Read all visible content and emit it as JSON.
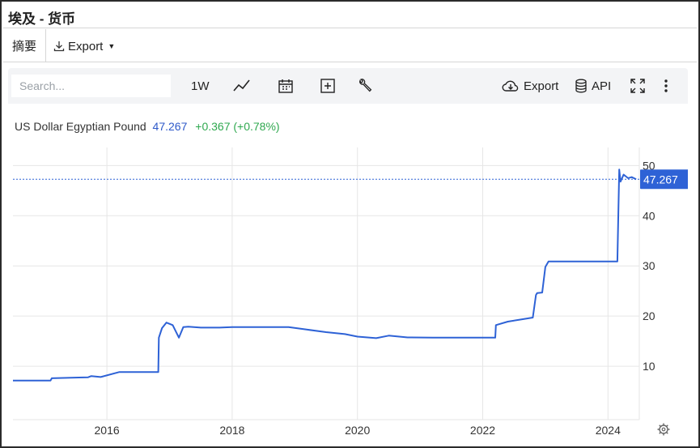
{
  "window": {
    "title": "埃及 - 货币"
  },
  "tabs": {
    "summary": "摘要",
    "export": "Export"
  },
  "toolbar": {
    "search_placeholder": "Search...",
    "interval": "1W",
    "export": "Export",
    "api": "API"
  },
  "legend": {
    "name": "US Dollar Egyptian Pound",
    "price": "47.267",
    "change": "+0.367 (+0.78%)"
  },
  "colors": {
    "line": "#2e62d6",
    "price_tag": "#2e62d6",
    "change": "#2fa84f"
  },
  "chart_data": {
    "type": "line",
    "title": "US Dollar Egyptian Pound",
    "xlabel": "",
    "ylabel": "",
    "xlim": [
      2014.5,
      2024.5
    ],
    "ylim": [
      0,
      52
    ],
    "x_ticks": [
      "2016",
      "2018",
      "2020",
      "2022",
      "2024"
    ],
    "y_ticks": [
      "10",
      "20",
      "30",
      "40",
      "50"
    ],
    "last_value": "47.267",
    "series": [
      {
        "x": [
          2014.5,
          2015.1,
          2015.12,
          2015.55,
          2015.7,
          2015.75,
          2015.9,
          2016.2,
          2016.21,
          2016.82,
          2016.83,
          2016.88,
          2016.95,
          2017.05,
          2017.15,
          2017.22,
          2017.3,
          2017.5,
          2017.8,
          2018.0,
          2018.5,
          2018.9,
          2019.2,
          2019.5,
          2019.8,
          2020.0,
          2020.3,
          2020.5,
          2020.8,
          2021.2,
          2021.8,
          2022.2,
          2022.21,
          2022.4,
          2022.6,
          2022.8,
          2022.85,
          2022.87,
          2022.95,
          2023.0,
          2023.05,
          2023.2,
          2023.5,
          2024.0,
          2024.15,
          2024.18,
          2024.2,
          2024.25,
          2024.32,
          2024.38,
          2024.45
        ],
        "y": [
          7.15,
          7.15,
          7.6,
          7.75,
          7.8,
          8.05,
          7.85,
          8.85,
          8.85,
          8.85,
          15.7,
          17.6,
          18.7,
          18.2,
          15.7,
          17.8,
          17.9,
          17.7,
          17.7,
          17.8,
          17.8,
          17.8,
          17.3,
          16.8,
          16.4,
          15.9,
          15.6,
          16.1,
          15.75,
          15.7,
          15.7,
          15.7,
          18.2,
          18.9,
          19.3,
          19.7,
          24.2,
          24.6,
          24.7,
          29.8,
          30.9,
          30.9,
          30.9,
          30.9,
          30.9,
          49.2,
          46.8,
          48.2,
          47.5,
          47.7,
          47.27
        ]
      }
    ],
    "grid": true,
    "y_axis_position": "right",
    "legend": "top-left"
  }
}
